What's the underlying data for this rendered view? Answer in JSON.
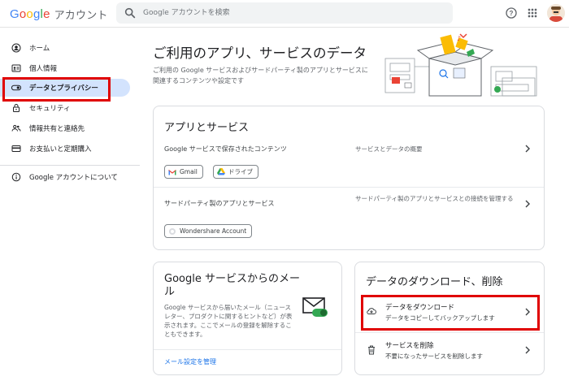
{
  "header": {
    "logo": {
      "google": "Google",
      "account": "アカウント"
    },
    "search_placeholder": "Google アカウントを検索"
  },
  "sidebar": {
    "items": [
      {
        "label": "ホーム",
        "icon": "person-circle-icon"
      },
      {
        "label": "個人情報",
        "icon": "id-card-icon"
      },
      {
        "label": "データとプライバシー",
        "icon": "toggle-icon"
      },
      {
        "label": "セキュリティ",
        "icon": "lock-icon"
      },
      {
        "label": "情報共有と連絡先",
        "icon": "people-icon"
      },
      {
        "label": "お支払いと定期購入",
        "icon": "credit-card-icon"
      }
    ],
    "about": {
      "label": "Google アカウントについて",
      "icon": "info-icon"
    },
    "active_index": 2
  },
  "main": {
    "title": "ご利用のアプリ、サービスのデータ",
    "description": "ご利用の Google サービスおよびサードパーティ製のアプリとサービスに関連するコンテンツや設定です"
  },
  "apps_card": {
    "title": "アプリとサービス",
    "google_row": {
      "label": "Google サービスで保存されたコンテンツ",
      "desc": "サービスとデータの概要",
      "chips": [
        "Gmail",
        "ドライブ"
      ]
    },
    "third_party_row": {
      "label": "サードパーティ製のアプリとサービス",
      "desc": "サードパーティ製のアプリとサービスとの接続を管理する",
      "chips": [
        "Wondershare Account"
      ]
    }
  },
  "email_card": {
    "title": "Google サービスからのメール",
    "body": "Google サービスから届いたメール（ニュースレター、プロダクトに関するヒントなど）が表示されます。ここでメールの登録を解除することもできます。",
    "link": "メール設定を管理"
  },
  "download_card": {
    "title": "データのダウンロード、削除",
    "download": {
      "title": "データをダウンロード",
      "sub": "データをコピーしてバックアップします"
    },
    "delete": {
      "title": "サービスを削除",
      "sub": "不要になったサービスを削除します"
    }
  },
  "colors": {
    "highlight": "#e00000",
    "active_bg": "#d3e3fd",
    "link": "#1a73e8"
  }
}
